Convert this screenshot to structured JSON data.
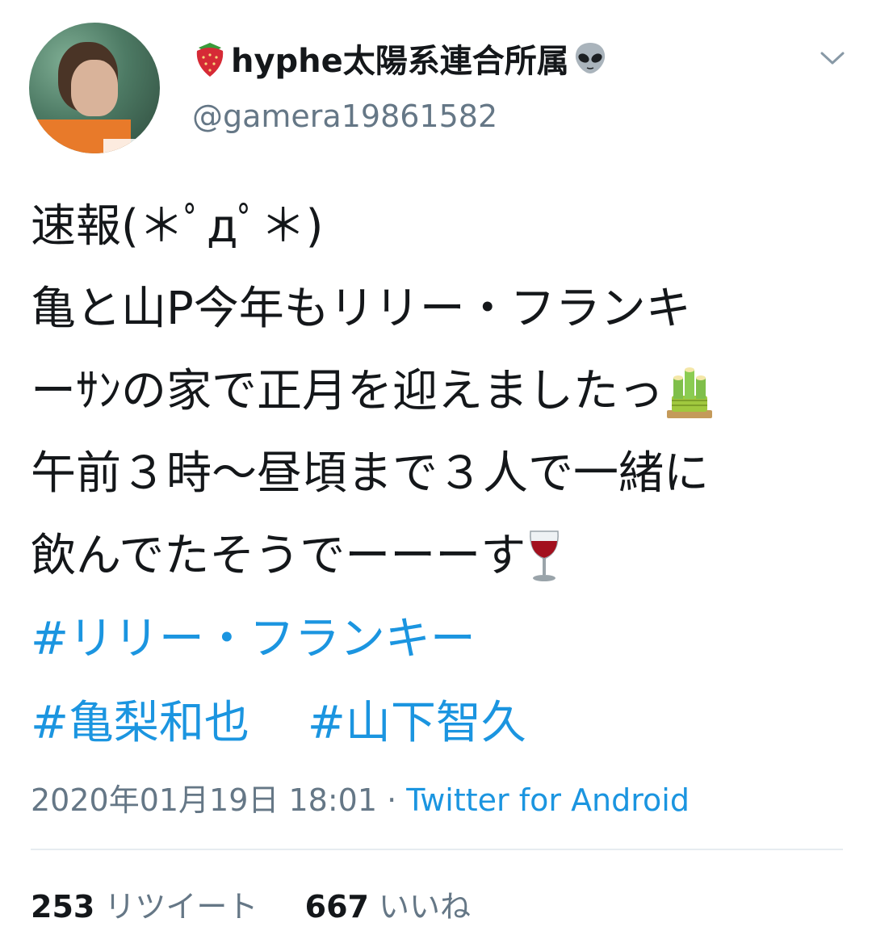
{
  "user": {
    "display_name": "hyphe太陽系連合所属",
    "handle": "@gamera19861582",
    "name_prefix_icon": "strawberry-icon",
    "name_suffix_icon": "alien-icon"
  },
  "tweet": {
    "lines": [
      "速報(＊ﾟдﾟ＊)",
      "亀と山P今年もリリー・フランキ",
      "ーｻﾝの家で正月を迎えましたっ",
      "午前３時〜昼頃まで３人で一緒に",
      "飲んでたそうでーーーす"
    ],
    "line3_icon": "kadomatsu-icon",
    "line5_icon": "wine-glass-icon",
    "hashtags": [
      "#リリー・フランキー",
      "#亀梨和也",
      "#山下智久"
    ]
  },
  "meta": {
    "timestamp": "2020年01月19日 18:01",
    "separator": "·",
    "source": "Twitter for Android"
  },
  "stats": {
    "retweets": "253",
    "retweets_label": "リツイート",
    "likes": "667",
    "likes_label": "いいね"
  },
  "colors": {
    "text": "#14171a",
    "secondary": "#657786",
    "link": "#1b95e0",
    "divider": "#e6ecf0"
  }
}
